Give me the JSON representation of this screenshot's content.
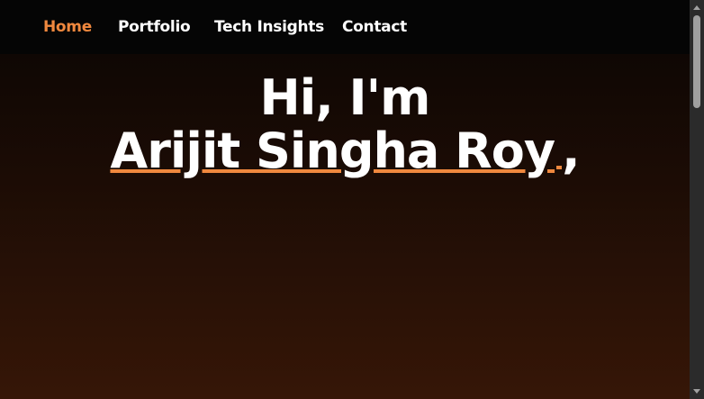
{
  "nav": {
    "items": [
      {
        "label": "Home",
        "active": true
      },
      {
        "label": "Portfolio",
        "active": false
      },
      {
        "label": "Tech Insights",
        "active": false
      },
      {
        "label": "Contact",
        "active": false
      }
    ]
  },
  "hero": {
    "greeting": "Hi, I'm",
    "name": "Arijit Singha Roy",
    "trailing": ","
  },
  "colors": {
    "accent": "#f0883e",
    "background_top": "#000000",
    "background_bottom": "#361607",
    "text": "#ffffff"
  },
  "scrollbar": {
    "position_fraction": 0
  }
}
